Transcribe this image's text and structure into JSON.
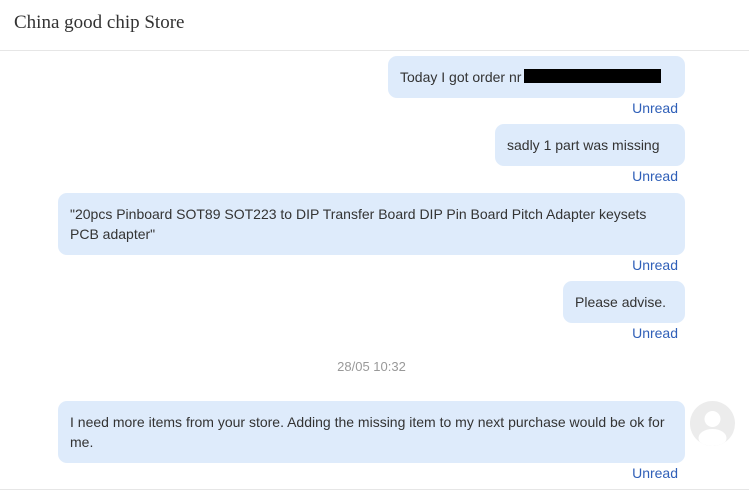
{
  "header": {
    "title": "China good chip Store"
  },
  "messages": [
    {
      "text": "Today I got order nr",
      "status": "Unread"
    },
    {
      "text": "sadly 1 part was missing",
      "status": "Unread"
    },
    {
      "text": "\"20pcs Pinboard SOT89 SOT223 to DIP Transfer Board DIP Pin Board Pitch Adapter keysets PCB adapter\"",
      "status": "Unread"
    },
    {
      "text": "Please advise.",
      "status": "Unread"
    },
    {
      "text": "I need more items from your store. Adding the missing item to my next purchase would be ok for me.",
      "status": "Unread"
    }
  ],
  "timestamp": "28/05 10:32",
  "colors": {
    "bubble": "#deebfb",
    "unread": "#2f5fb8",
    "timestamp": "#999999"
  },
  "icons": {
    "avatar": "user-avatar-icon"
  }
}
